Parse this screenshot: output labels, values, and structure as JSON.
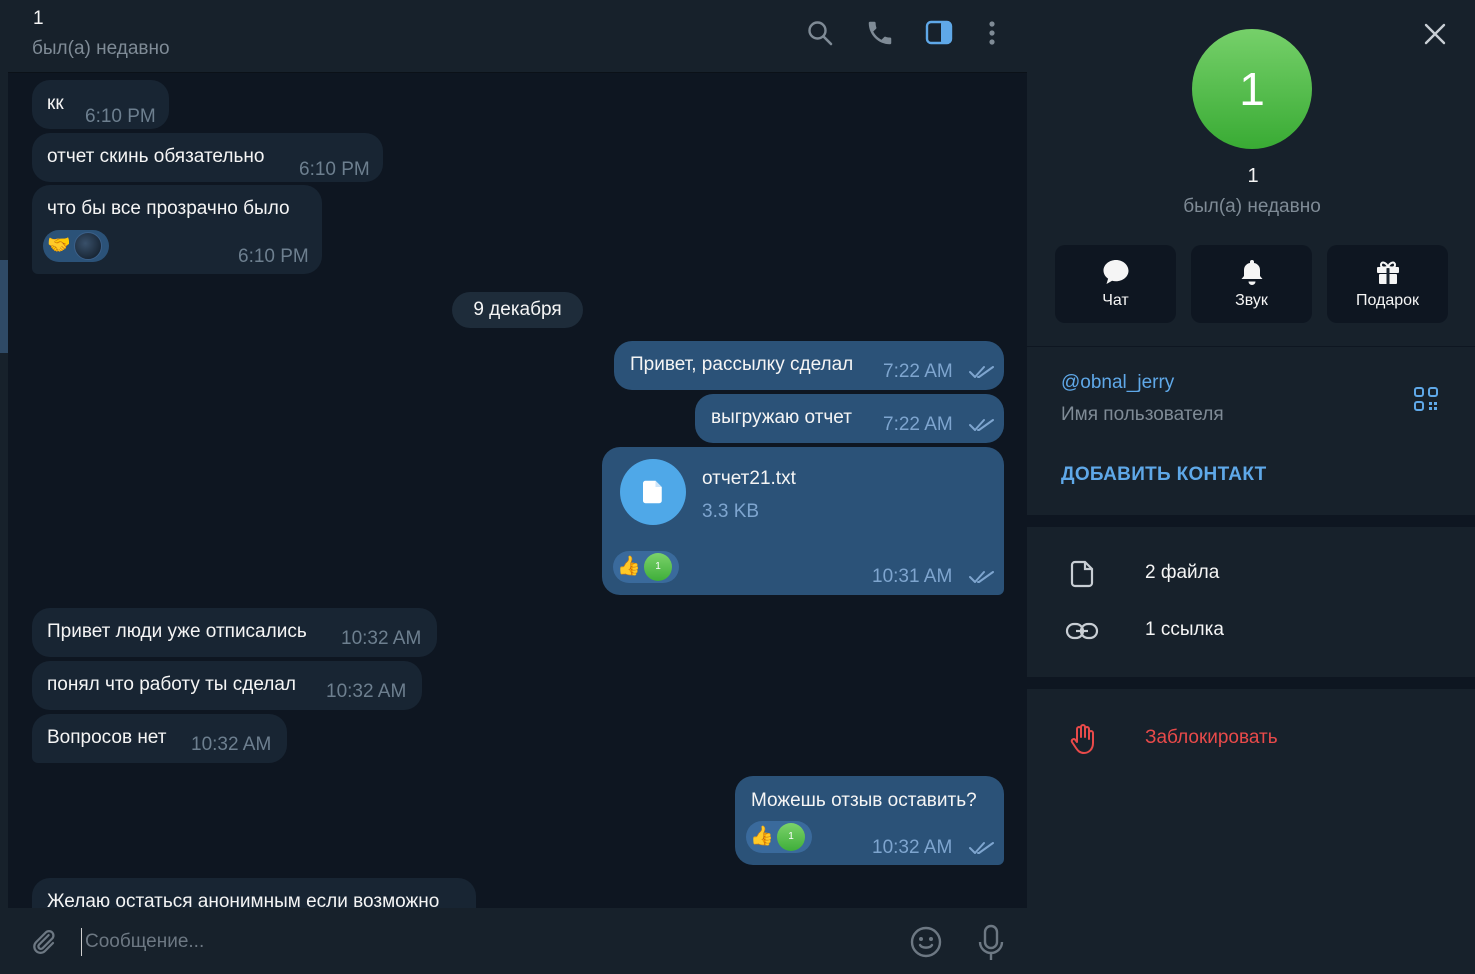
{
  "colors": {
    "accent": "#5fa8e8",
    "danger": "#e84a4a",
    "incoming": "#182533",
    "outgoing": "#2b5278",
    "background": "#0e1621"
  },
  "header": {
    "title": "1",
    "status": "был(а) недавно",
    "icons": [
      "search-icon",
      "phone-icon",
      "sidebar-icon",
      "more-icon"
    ]
  },
  "messages": {
    "m1": {
      "text": "кк",
      "time": "6:10 PM"
    },
    "m2": {
      "text": "отчет скинь обязательно",
      "time": "6:10 PM"
    },
    "m3": {
      "text": "что бы все прозрачно было",
      "time": "6:10 PM",
      "reaction": "🤝"
    },
    "date": "9 декабря",
    "m4": {
      "text": "Привет, рассылку сделал",
      "time": "7:22 AM"
    },
    "m5": {
      "text": "выгружаю отчет",
      "time": "7:22 AM"
    },
    "m6": {
      "file_name": "отчет21.txt",
      "file_size": "3.3 KB",
      "time": "10:31 AM",
      "reaction": "👍",
      "reaction_count": "1"
    },
    "m7": {
      "text": "Привет люди уже отписались",
      "time": "10:32 AM"
    },
    "m8": {
      "text": "понял что работу ты сделал",
      "time": "10:32 AM"
    },
    "m9": {
      "text": "Вопросов нет",
      "time": "10:32 AM"
    },
    "m10": {
      "text": "Можешь отзыв оставить?",
      "time": "10:32 AM",
      "reaction": "👍",
      "reaction_count": "1"
    },
    "m11": {
      "text": "Желаю остаться анонимным если возможно"
    }
  },
  "composer": {
    "placeholder": "Сообщение..."
  },
  "profile": {
    "avatar_letter": "1",
    "name": "1",
    "status": "был(а) недавно",
    "actions": [
      {
        "label": "Чат",
        "icon": "chat-icon"
      },
      {
        "label": "Звук",
        "icon": "bell-icon"
      },
      {
        "label": "Подарок",
        "icon": "gift-icon"
      }
    ],
    "username": "@obnal_jerry",
    "username_caption": "Имя пользователя",
    "add_contact": "ДОБАВИТЬ КОНТАКТ",
    "files": "2 файла",
    "links": "1 ссылка",
    "block": "Заблокировать"
  }
}
